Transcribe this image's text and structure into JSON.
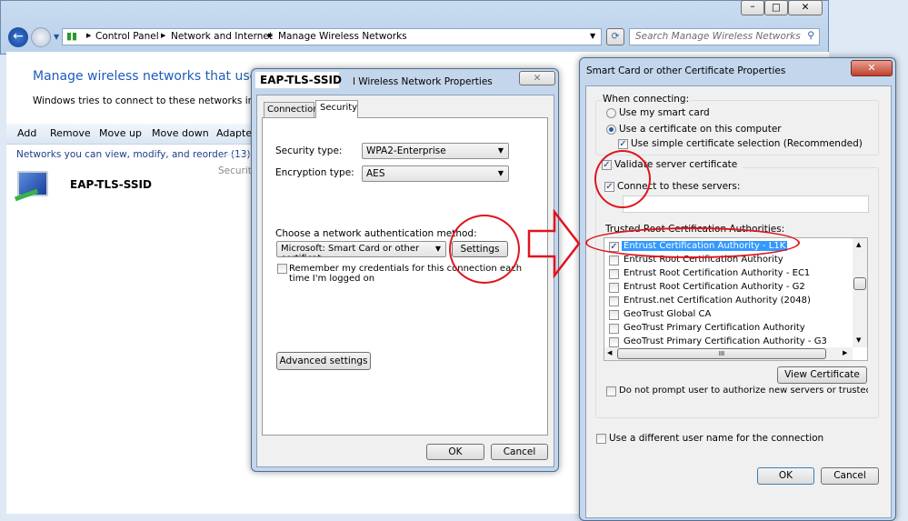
{
  "explorer": {
    "breadcrumb": [
      "Control Panel",
      "Network and Internet",
      "Manage Wireless Networks"
    ],
    "search_placeholder": "Search Manage Wireless Networks",
    "title": "Manage wireless networks that use (Wi",
    "subtitle": "Windows tries to connect to these networks in the o",
    "toolbar": [
      "Add",
      "Remove",
      "Move up",
      "Move down",
      "Adapter"
    ],
    "group_header": "Networks you can view, modify, and reorder (13)",
    "network": {
      "name": "EAP-TLS-SSID",
      "column": "Security"
    }
  },
  "props_dialog": {
    "title_ssid": "EAP-TLS-SSID",
    "title_rest": "l Wireless Network Properties",
    "tabs": [
      "Connection",
      "Security"
    ],
    "active_tab": "Security",
    "security_type_label": "Security type:",
    "security_type": "WPA2-Enterprise",
    "encryption_type_label": "Encryption type:",
    "encryption_type": "AES",
    "auth_label": "Choose a network authentication method:",
    "auth_method": "Microsoft: Smart Card or other certificat",
    "settings": "Settings",
    "remember_line1": "Remember my credentials for this connection each",
    "remember_line2": "time I'm logged on",
    "remember_checked": false,
    "advanced": "Advanced settings",
    "ok": "OK",
    "cancel": "Cancel"
  },
  "cert_dialog": {
    "title": "Smart Card or other Certificate Properties",
    "when_connecting": "When connecting:",
    "use_smart_card": "Use my smart card",
    "use_certificate": "Use a certificate on this computer",
    "selected_option": "Use a certificate on this computer",
    "simple_selection": "Use simple certificate selection (Recommended)",
    "validate": "Validate server certificate",
    "connect_servers": "Connect to these servers:",
    "servers_value": "",
    "trusted_label": "Trusted Root Certification Authorities:",
    "authorities": [
      {
        "name": "Entrust Certification Authority - L1K",
        "checked": true,
        "selected": true
      },
      {
        "name": "Entrust Root Certification Authority",
        "checked": false
      },
      {
        "name": "Entrust Root Certification Authority - EC1",
        "checked": false
      },
      {
        "name": "Entrust Root Certification Authority - G2",
        "checked": false
      },
      {
        "name": "Entrust.net Certification Authority (2048)",
        "checked": false
      },
      {
        "name": "GeoTrust Global CA",
        "checked": false
      },
      {
        "name": "GeoTrust Primary Certification Authority",
        "checked": false
      },
      {
        "name": "GeoTrust Primary Certification Authority - G3",
        "checked": false
      }
    ],
    "view_certificate": "View Certificate",
    "do_not_prompt": "Do not prompt user to authorize new servers or trusted certification",
    "different_user": "Use a different user name for the connection",
    "ok": "OK",
    "cancel": "Cancel"
  },
  "colors": {
    "annotation": "#e0141e",
    "link": "#1e5bb8",
    "selection": "#3399ff"
  }
}
